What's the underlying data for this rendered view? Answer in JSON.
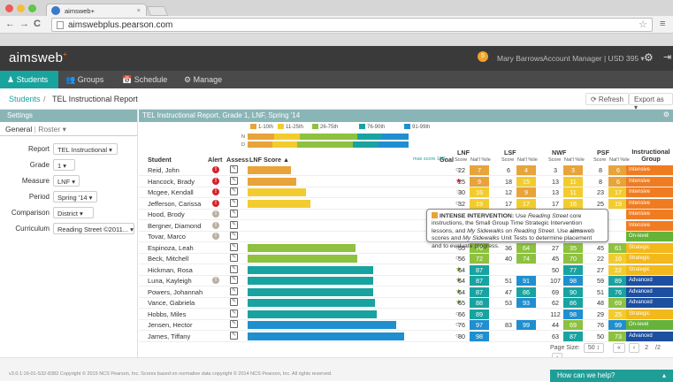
{
  "browser": {
    "tab_title": "aimsweb+",
    "tab_close": "×",
    "back": "←",
    "forward": "→",
    "reload": "C",
    "url": "aimswebplus.pearson.com",
    "star": "☆",
    "menu": "≡"
  },
  "app": {
    "logo": "aimsweb",
    "logo_plus": "+",
    "notif_count": "5",
    "user_name": "Mary Barrows",
    "account": "Account Manager | USD 395 ▾",
    "settings_icon": "⚙",
    "logout_icon": "⇥"
  },
  "nav": {
    "items": [
      "Students",
      "Groups",
      "Schedule",
      "Manage"
    ],
    "icons": [
      "♟",
      "👥",
      "📅",
      "⚙"
    ]
  },
  "breadcrumb": {
    "root": "Students",
    "sep": " / ",
    "current": "TEL Instructional Report",
    "refresh": "⟳ Refresh",
    "export": "Export as ▾"
  },
  "settings": {
    "header": "Settings",
    "tab_general": "General",
    "tab_sep": " | ",
    "tab_roster": "Roster ▾",
    "fields": [
      {
        "label": "Report",
        "value": "TEL Instructional ▾"
      },
      {
        "label": "Grade",
        "value": "1 ▾"
      },
      {
        "label": "Measure",
        "value": "LNF ▾"
      },
      {
        "label": "Period",
        "value": "Spring '14 ▾"
      },
      {
        "label": "Comparison",
        "value": "District ▾"
      },
      {
        "label": "Curriculum",
        "value": "Reading Street ©2011... ▾"
      }
    ]
  },
  "report": {
    "header": "TEL Instructional Report, Grade 1, LNF, Spring '14",
    "gear": "⚙",
    "legend": [
      {
        "label": "1-10th",
        "color": "#e8a33a"
      },
      {
        "label": "11-25th",
        "color": "#f2cc2f"
      },
      {
        "label": "26-75th",
        "color": "#8dc13f"
      },
      {
        "label": "76-90th",
        "color": "#19a3a0"
      },
      {
        "label": "91-99th",
        "color": "#1f8fcf"
      }
    ],
    "band_labels": [
      "N",
      "D"
    ],
    "columns": {
      "student": "Student",
      "alert": "Alert",
      "assess": "Assess",
      "score": "LNF Score ▲",
      "max": "max score 100",
      "goal": "Goal",
      "lnf": "LNF",
      "lsf": "LSF",
      "nwf": "NWF",
      "psf": "PSF",
      "group": "Instructional Group",
      "score_sub": "Score",
      "natl_sub": "Nat'l %ile"
    },
    "rows": [
      {
        "name": "Reid, John",
        "alert": "red",
        "score": 22,
        "goal": "○",
        "lnf": [
          22,
          7
        ],
        "lsf": [
          6,
          4
        ],
        "nwf": [
          3,
          3
        ],
        "psf": [
          8,
          6
        ],
        "group": "Intensive"
      },
      {
        "name": "Hancock, Brady",
        "alert": "red",
        "score": 25,
        "goal": "★",
        "lnf": [
          25,
          9
        ],
        "lsf": [
          18,
          15
        ],
        "nwf": [
          13,
          11
        ],
        "psf": [
          8,
          6
        ],
        "group": "Intensive"
      },
      {
        "name": "Mcgee, Kendall",
        "alert": "red",
        "score": 30,
        "goal": "☆",
        "lnf": [
          30,
          16
        ],
        "lsf": [
          12,
          9
        ],
        "nwf": [
          13,
          11
        ],
        "psf": [
          23,
          17
        ],
        "group": "Intensive"
      },
      {
        "name": "Jefferson, Carissa",
        "alert": "red",
        "score": 32,
        "goal": "○",
        "lnf": [
          32,
          19
        ],
        "lsf": [
          17,
          17
        ],
        "nwf": [
          17,
          16
        ],
        "psf": [
          25,
          19
        ],
        "group": "Intensive"
      },
      {
        "name": "Hood, Brody",
        "alert": "gray",
        "score": 0,
        "goal": "",
        "lnf": [
          "",
          ""
        ],
        "lsf": [
          "",
          ""
        ],
        "nwf": [
          "",
          ""
        ],
        "psf": [
          "",
          ""
        ],
        "group": "Intensive"
      },
      {
        "name": "Bergner, Diamond",
        "alert": "gray",
        "score": 0,
        "goal": "",
        "lnf": [
          "",
          ""
        ],
        "lsf": [
          "",
          ""
        ],
        "nwf": [
          "",
          ""
        ],
        "psf": [
          "",
          ""
        ],
        "group": "Intensive"
      },
      {
        "name": "Tovar, Marco",
        "alert": "gray",
        "score": 0,
        "goal": "",
        "lnf": [
          "",
          ""
        ],
        "lsf": [
          "",
          ""
        ],
        "nwf": [
          "",
          ""
        ],
        "psf": [
          "",
          ""
        ],
        "group": "On-level"
      },
      {
        "name": "Espinoza, Leah",
        "alert": "",
        "score": 55,
        "goal": "○",
        "lnf": [
          55,
          70
        ],
        "lsf": [
          36,
          64
        ],
        "nwf": [
          27,
          35
        ],
        "psf": [
          45,
          61
        ],
        "group": "Strategic"
      },
      {
        "name": "Beck, Mitchell",
        "alert": "",
        "score": 56,
        "goal": "○",
        "lnf": [
          56,
          72
        ],
        "lsf": [
          40,
          74
        ],
        "nwf": [
          45,
          70
        ],
        "psf": [
          22,
          16
        ],
        "group": "Strategic"
      },
      {
        "name": "Hickman, Rosa",
        "alert": "",
        "score": 64,
        "goal": "★",
        "lnf": [
          64,
          87
        ],
        "lsf": [
          "",
          ""
        ],
        "nwf": [
          50,
          77
        ],
        "psf": [
          27,
          22
        ],
        "group": "Strategic"
      },
      {
        "name": "Luna, Kayleigh",
        "alert": "gray",
        "score": 64,
        "goal": "★",
        "lnf": [
          64,
          87
        ],
        "lsf": [
          51,
          91
        ],
        "nwf": [
          107,
          98
        ],
        "psf": [
          59,
          89
        ],
        "group": "Advanced"
      },
      {
        "name": "Powers, Johannah",
        "alert": "",
        "score": 64,
        "goal": "★",
        "lnf": [
          64,
          87
        ],
        "lsf": [
          47,
          86
        ],
        "nwf": [
          69,
          90
        ],
        "psf": [
          51,
          76
        ],
        "group": "Advanced"
      },
      {
        "name": "Vance, Gabriela",
        "alert": "",
        "score": 65,
        "goal": "★",
        "lnf": [
          65,
          88
        ],
        "lsf": [
          53,
          93
        ],
        "nwf": [
          62,
          86
        ],
        "psf": [
          48,
          69
        ],
        "group": "Advanced"
      },
      {
        "name": "Hobbs, Miles",
        "alert": "",
        "score": 66,
        "goal": "○",
        "lnf": [
          66,
          89
        ],
        "lsf": [
          "",
          ""
        ],
        "nwf": [
          112,
          98
        ],
        "psf": [
          29,
          25
        ],
        "group": "Strategic"
      },
      {
        "name": "Jensen, Hector",
        "alert": "",
        "score": 76,
        "goal": "○",
        "lnf": [
          76,
          97
        ],
        "lsf": [
          83,
          99
        ],
        "nwf": [
          44,
          69
        ],
        "psf": [
          76,
          99
        ],
        "group": "On-level"
      },
      {
        "name": "James, Tiffany",
        "alert": "",
        "score": 80,
        "goal": "○",
        "lnf": [
          80,
          98
        ],
        "lsf": [
          "",
          ""
        ],
        "nwf": [
          63,
          87
        ],
        "psf": [
          50,
          73
        ],
        "group": "Advanced"
      }
    ],
    "callout": {
      "title": "INTENSE INTERVENTION:",
      "text1": " Use ",
      "em1": "Reading Street",
      "text2": " core instructions, the Small Group Time Strategic Intervention lessons, and ",
      "em2": "My Sidewalks on Reading Street",
      "text3": ". Use ",
      "bold": "aims",
      "text4": "web scores and ",
      "em3": "My Sidewalks",
      "text5": " Unit Tests to determine placement and to evaluate progress."
    },
    "pager": {
      "label": "Page Size:",
      "size": "50 ↕",
      "first": "«",
      "prev": "‹",
      "page": "2",
      "of": "/2",
      "next": "›",
      "last": "»"
    }
  },
  "footer": {
    "text": "v3.0.1:16-01-S32-8382 Copyright © 2015 NCS Pearson, Inc. Scores based on normative data copyright © 2014 NCS Pearson, Inc. All rights reserved.",
    "help": "How can we help?",
    "help_arrow": "▴"
  },
  "colors": {
    "teal": "#19a39e",
    "orange": "#e8a33a",
    "yellow": "#f2cc2f",
    "green": "#8dc13f",
    "aqua": "#19a3a0",
    "blue": "#1f8fcf",
    "intensive": "#f07c22",
    "strategic": "#f2b81c",
    "advanced": "#1d4fa0",
    "onlevel": "#66b33a"
  }
}
